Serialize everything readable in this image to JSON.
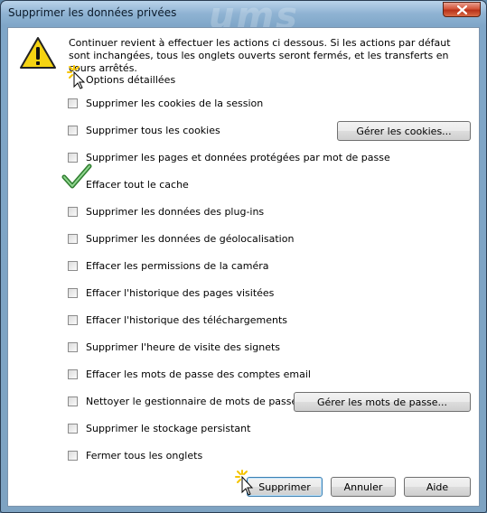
{
  "window": {
    "title": "Supprimer les données privées",
    "watermark": "ums"
  },
  "message": "Continuer revient à effectuer les actions ci dessous. Si les actions par défaut sont inchangées, tous les onglets ouverts seront fermés, et les transferts en cours arrêtés.",
  "options_label": "Options détaillées",
  "options": [
    {
      "label": "Supprimer les cookies de la session",
      "checked": false
    },
    {
      "label": "Supprimer tous les cookies",
      "checked": false
    },
    {
      "label": "Supprimer les pages et données protégées par mot de passe",
      "checked": false
    },
    {
      "label": "Effacer tout le cache",
      "checked": true
    },
    {
      "label": "Supprimer les données des plug-ins",
      "checked": false
    },
    {
      "label": "Supprimer les données de géolocalisation",
      "checked": false
    },
    {
      "label": "Effacer les permissions de la caméra",
      "checked": false
    },
    {
      "label": "Effacer l'historique des pages visitées",
      "checked": false
    },
    {
      "label": "Effacer l'historique des téléchargements",
      "checked": false
    },
    {
      "label": "Supprimer l'heure de visite des signets",
      "checked": false
    },
    {
      "label": "Effacer les mots de passe des comptes email",
      "checked": false
    },
    {
      "label": "Nettoyer le gestionnaire de mots de passe",
      "checked": false
    },
    {
      "label": "Supprimer le stockage persistant",
      "checked": false
    },
    {
      "label": "Fermer tous les onglets",
      "checked": false
    }
  ],
  "buttons": {
    "manage_cookies": "Gérer les cookies...",
    "manage_passwords": "Gérer les mots de passe...",
    "delete": "Supprimer",
    "cancel": "Annuler",
    "help": "Aide"
  },
  "icons": {
    "warning": "warning-icon",
    "close": "close-icon",
    "check": "checkmark-icon",
    "cursor": "mouse-pointer-icon"
  },
  "colors": {
    "title_bar": "#8fb3d3",
    "warning_yellow": "#f5d312",
    "close_red": "#d4553a",
    "check_green": "#3a9a3a"
  }
}
